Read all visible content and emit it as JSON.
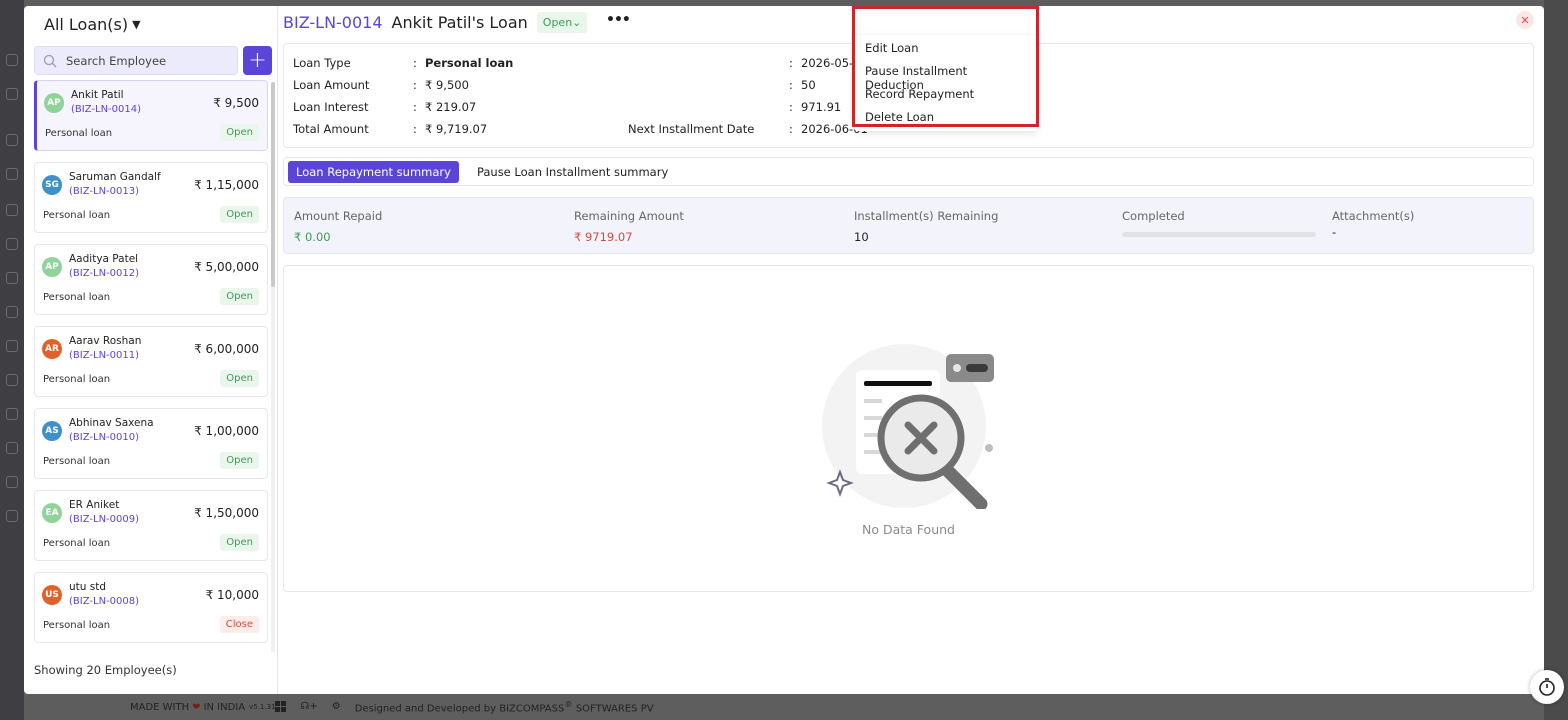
{
  "left_panel": {
    "filter_label": "All Loan(s)",
    "search_placeholder": "Search Employee",
    "add_label": "+",
    "showing": "Showing 20 Employee(s)",
    "cards": [
      {
        "initials": "AP",
        "name": "Ankit Patil",
        "id": "(BIZ-LN-0014)",
        "amount": "₹ 9,500",
        "type": "Personal loan",
        "status": "Open",
        "avatar_color": "#8fd39a"
      },
      {
        "initials": "SG",
        "name": "Saruman Gandalf",
        "id": "(BIZ-LN-0013)",
        "amount": "₹ 1,15,000",
        "type": "Personal loan",
        "status": "Open",
        "avatar_color": "#3f8fc9"
      },
      {
        "initials": "AP",
        "name": "Aaditya Patel",
        "id": "(BIZ-LN-0012)",
        "amount": "₹ 5,00,000",
        "type": "Personal loan",
        "status": "Open",
        "avatar_color": "#8fd39a"
      },
      {
        "initials": "AR",
        "name": "Aarav Roshan",
        "id": "(BIZ-LN-0011)",
        "amount": "₹ 6,00,000",
        "type": "Personal loan",
        "status": "Open",
        "avatar_color": "#e0622a"
      },
      {
        "initials": "AS",
        "name": "Abhinav Saxena",
        "id": "(BIZ-LN-0010)",
        "amount": "₹ 1,00,000",
        "type": "Personal loan",
        "status": "Open",
        "avatar_color": "#3f8fc9"
      },
      {
        "initials": "EA",
        "name": "ER Aniket",
        "id": "(BIZ-LN-0009)",
        "amount": "₹ 1,50,000",
        "type": "Personal loan",
        "status": "Open",
        "avatar_color": "#8fd39a"
      },
      {
        "initials": "US",
        "name": "utu std",
        "id": "(BIZ-LN-0008)",
        "amount": "₹ 10,000",
        "type": "Personal loan",
        "status": "Close",
        "avatar_color": "#e0622a"
      }
    ]
  },
  "header": {
    "loan_id": "BIZ-LN-0014",
    "loan_name": "Ankit Patil's Loan",
    "status": "Open",
    "more": "•••",
    "close": "✕"
  },
  "details": {
    "left": [
      {
        "label": "Loan Type",
        "value": "Personal loan"
      },
      {
        "label": "Loan Amount",
        "value": "₹ 9,500"
      },
      {
        "label": "Loan Interest",
        "value": "₹ 219.07"
      },
      {
        "label": "Total Amount",
        "value": "₹ 9,719.07"
      }
    ],
    "right": [
      {
        "value": "2026-05-26"
      },
      {
        "value": "50"
      },
      {
        "value": "971.91"
      },
      {
        "label": "Next Installment Date",
        "value": "2026-06-01"
      }
    ],
    "sep": ":"
  },
  "menu": {
    "items": [
      "Edit Loan",
      "Pause Installment Deduction",
      "Record Repayment",
      "Delete Loan"
    ]
  },
  "tabs": [
    "Loan Repayment summary",
    "Pause Loan Installment summary"
  ],
  "summary": {
    "amount_repaid_label": "Amount Repaid",
    "amount_repaid": "₹ 0.00",
    "remaining_label": "Remaining Amount",
    "remaining": "₹ 9719.07",
    "installments_label": "Installment(s) Remaining",
    "installments": "10",
    "completed_label": "Completed",
    "completed_fraction": 0,
    "attachments_label": "Attachment(s)",
    "attachments": "-"
  },
  "empty_state": "No Data Found",
  "footer": {
    "made_with": "MADE WITH",
    "in_india": "IN INDIA",
    "version": "v5.1.31",
    "designed": "Designed and Developed by",
    "company": "BIZCOMPASS",
    "reg": "®",
    "company_suffix": "SOFTWARES PV"
  },
  "colors": {
    "accent": "#5b45d6",
    "open": "#3d9a55",
    "close": "#d24b43",
    "highlight": "#d0232a"
  }
}
